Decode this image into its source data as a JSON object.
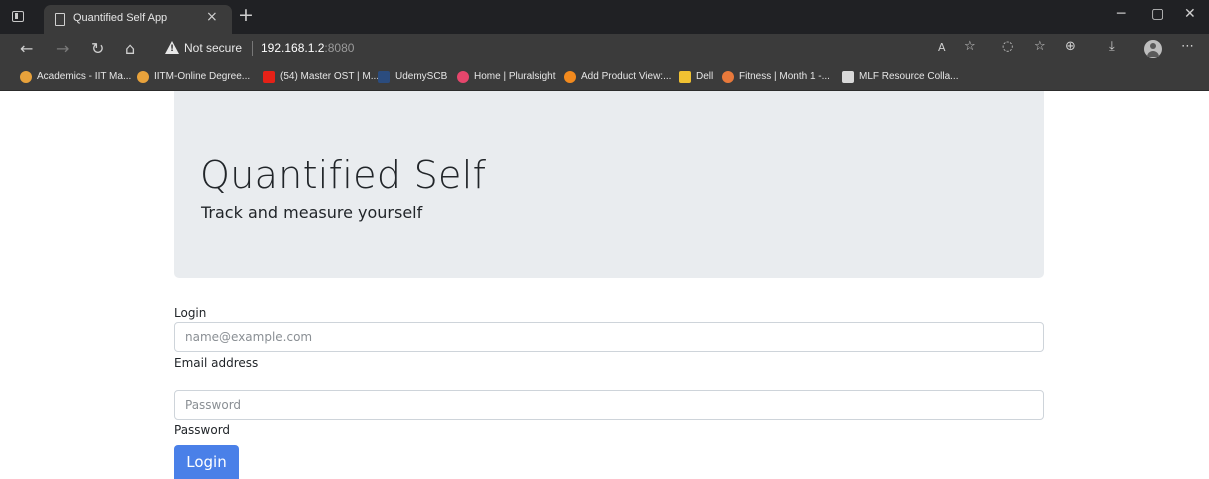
{
  "browser": {
    "tab_title": "Quantified Self App",
    "tab_close": "×",
    "new_tab": "+",
    "security_label": "Not secure",
    "url_host": "192.168.1.2",
    "url_port": ":8080",
    "bookmarks": [
      {
        "label": "Academics - IIT Ma...",
        "icon_color": "#e8a23b"
      },
      {
        "label": "IITM-Online Degree...",
        "icon_color": "#e8a23b"
      },
      {
        "label": "(54) Master OST | M...",
        "icon_color": "#e62117"
      },
      {
        "label": "UdemySCB",
        "icon_color": "#2b4c7e"
      },
      {
        "label": "Home | Pluralsight",
        "icon_color": "#e6466c"
      },
      {
        "label": "Add Product View:...",
        "icon_color": "#f28a1e"
      },
      {
        "label": "Dell",
        "icon_color": "#f1c232"
      },
      {
        "label": "Fitness | Month 1 -...",
        "icon_color": "#e8793b"
      },
      {
        "label": "MLF Resource Colla...",
        "icon_color": "#d9d9d9"
      }
    ]
  },
  "jumbotron": {
    "title": "Quantified Self",
    "subtitle": "Track and measure yourself"
  },
  "form": {
    "heading": "Login",
    "email_placeholder": "name@example.com",
    "email_label": "Email address",
    "password_placeholder": "Password",
    "password_label": "Password",
    "submit_label": "Login"
  },
  "colors": {
    "jumbotron_bg": "#e9ecef",
    "primary": "#4a80e8",
    "chrome_dark": "#202124",
    "chrome_toolbar": "#3b3b3b"
  }
}
